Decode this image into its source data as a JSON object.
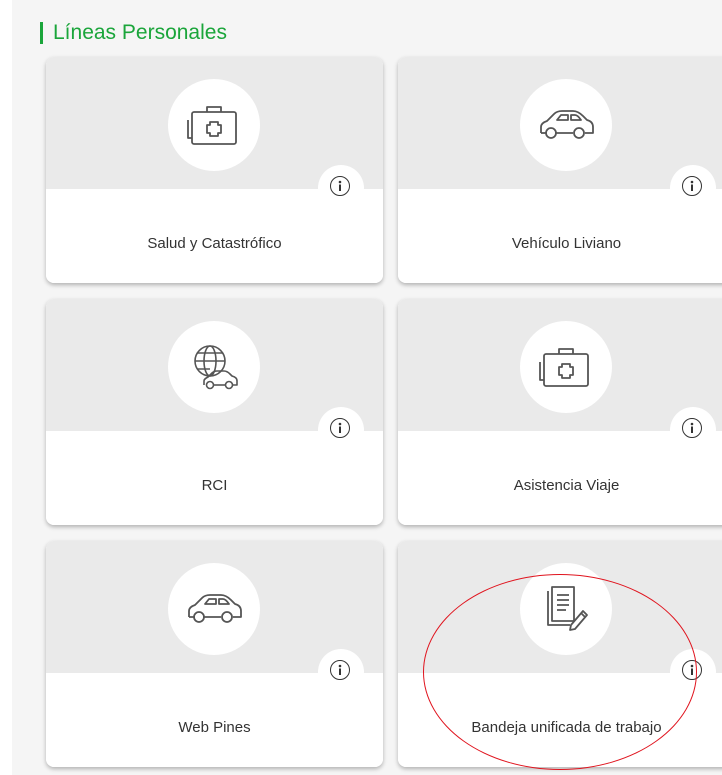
{
  "section": {
    "title": "Líneas Personales"
  },
  "colors": {
    "accent": "#1aa53a",
    "annotation": "#e0141e"
  },
  "cards": [
    {
      "label": "Salud y Catastrófico",
      "icon": "medical-kit-icon"
    },
    {
      "label": "Vehículo Liviano",
      "icon": "car-icon"
    },
    {
      "label": "RCI",
      "icon": "globe-car-icon"
    },
    {
      "label": "Asistencia Viaje",
      "icon": "medical-kit-icon"
    },
    {
      "label": "Web Pines",
      "icon": "car-icon"
    },
    {
      "label": "Bandeja unificada de trabajo",
      "icon": "document-edit-icon"
    }
  ],
  "info_icon": "info-icon"
}
